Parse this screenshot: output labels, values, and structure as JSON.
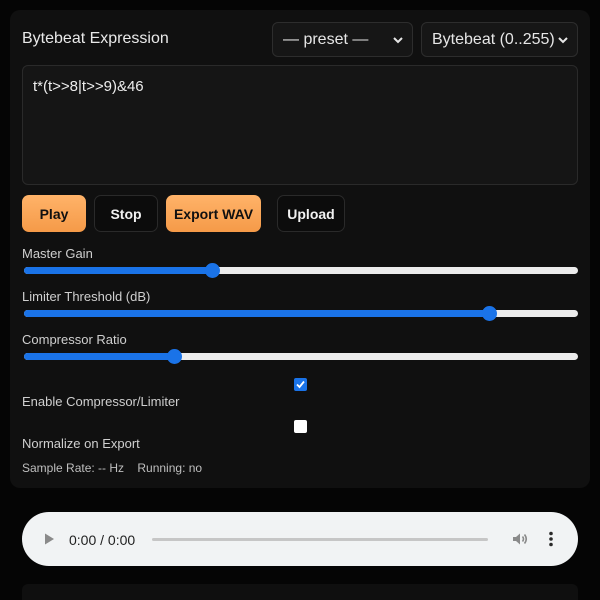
{
  "editor": {
    "title": "Bytebeat Expression",
    "preset_select": "— preset —",
    "mode_select": "Bytebeat (0..255)",
    "expression": "t*(t>>8|t>>9)&46"
  },
  "buttons": {
    "play": "Play",
    "stop": "Stop",
    "export": "Export WAV",
    "upload": "Upload"
  },
  "controls": {
    "master_gain": {
      "label": "Master Gain",
      "value_fraction": 0.34
    },
    "limiter_threshold": {
      "label": "Limiter Threshold (dB)",
      "value_fraction": 0.84
    },
    "compressor_ratio": {
      "label": "Compressor Ratio",
      "value_fraction": 0.27
    },
    "enable_compressor": {
      "label": "Enable Compressor/Limiter",
      "checked": true
    },
    "normalize": {
      "label": "Normalize on Export",
      "checked": false
    }
  },
  "status": {
    "text": "Sample Rate: -- Hz    Running: no"
  },
  "player": {
    "time": "0:00 / 0:00"
  },
  "colors": {
    "accent": "#f59a48",
    "slider": "#1a73e8"
  }
}
